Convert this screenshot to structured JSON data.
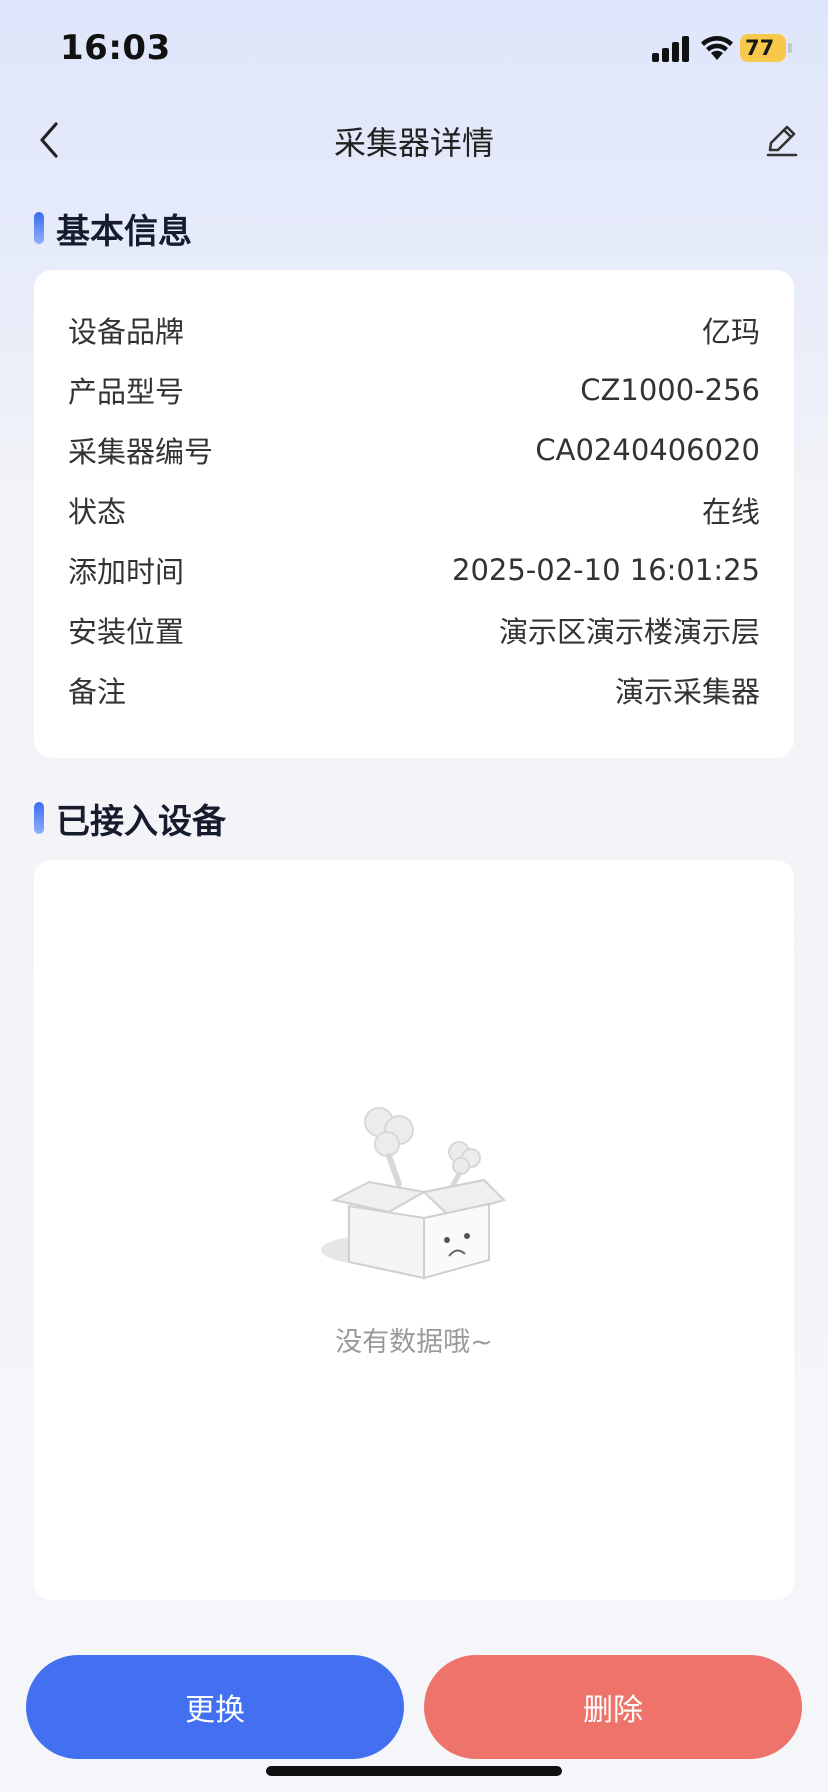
{
  "status_bar": {
    "time": "16:03",
    "battery": "77"
  },
  "header": {
    "title": "采集器详情",
    "back_icon": "chevron-left-icon",
    "edit_icon": "pencil-icon"
  },
  "basic_info": {
    "heading": "基本信息",
    "rows": [
      {
        "label": "设备品牌",
        "value": "亿玛"
      },
      {
        "label": "产品型号",
        "value": "CZ1000-256"
      },
      {
        "label": "采集器编号",
        "value": "CA0240406020"
      },
      {
        "label": "状态",
        "value": "在线"
      },
      {
        "label": "添加时间",
        "value": "2025-02-10 16:01:25"
      },
      {
        "label": "安装位置",
        "value": "演示区演示楼演示层"
      },
      {
        "label": "备注",
        "value": "演示采集器"
      }
    ]
  },
  "connected_devices": {
    "heading": "已接入设备",
    "empty_text": "没有数据哦~",
    "empty_icon": "empty-box-icon"
  },
  "actions": {
    "replace_label": "更换",
    "delete_label": "删除",
    "replace_color": "#4270f0",
    "delete_color": "#ee736a"
  }
}
